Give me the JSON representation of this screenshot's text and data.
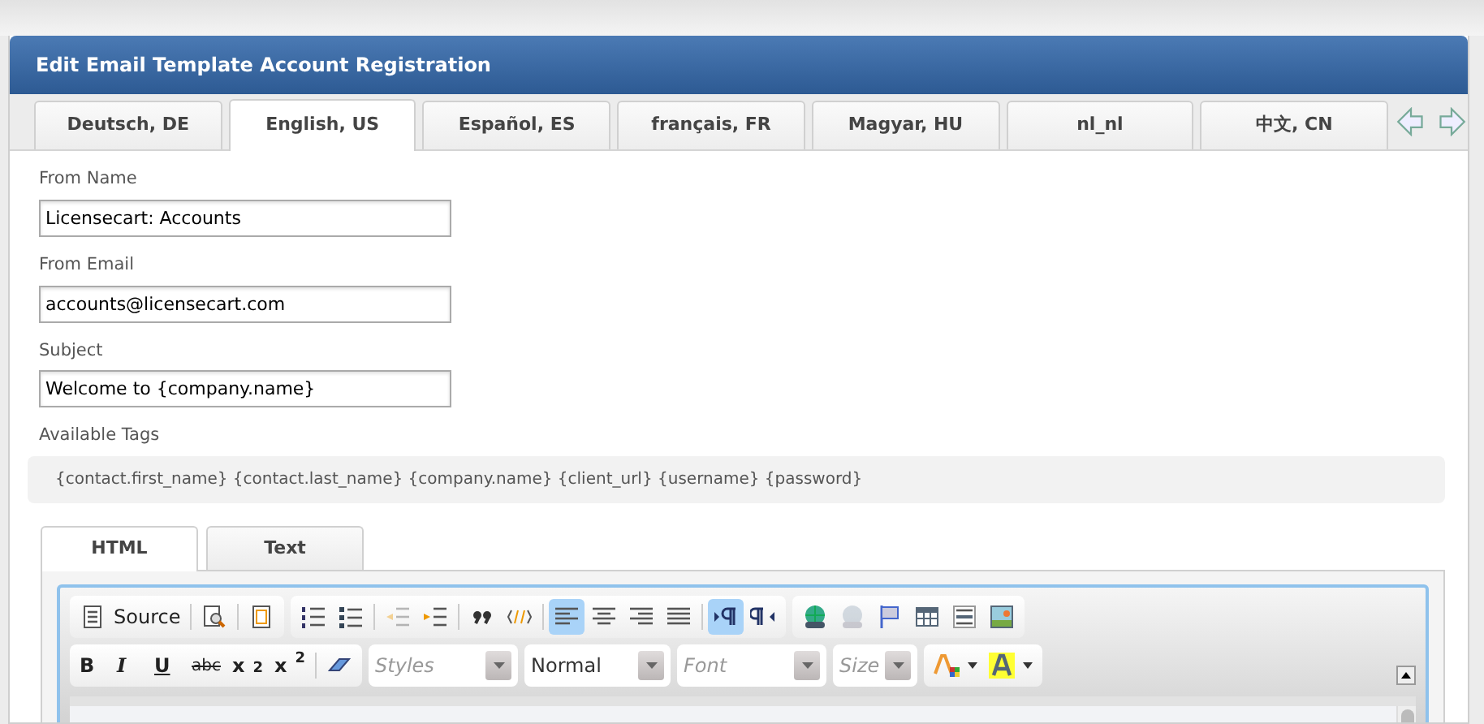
{
  "window": {
    "title": "Edit Email Template Account Registration"
  },
  "language_tabs": [
    {
      "label": "Deutsch, DE",
      "selected": false
    },
    {
      "label": "English, US",
      "selected": true
    },
    {
      "label": "Español, ES",
      "selected": false
    },
    {
      "label": "français, FR",
      "selected": false
    },
    {
      "label": "Magyar, HU",
      "selected": false
    },
    {
      "label": "nl_nl",
      "selected": false
    },
    {
      "label": "中文, CN",
      "selected": false
    }
  ],
  "fields": [
    {
      "label": "From Name",
      "value": "Licensecart: Accounts"
    },
    {
      "label": "From Email",
      "value": "accounts@licensecart.com"
    },
    {
      "label": "Subject",
      "value": "Welcome to {company.name}"
    }
  ],
  "available_tags": {
    "label": "Available Tags",
    "text": "{contact.first_name} {contact.last_name} {company.name} {client_url} {username} {password}"
  },
  "editor_tabs": [
    {
      "label": "HTML",
      "selected": true
    },
    {
      "label": "Text",
      "selected": false
    }
  ],
  "toolbar_row_1": [
    [
      {
        "label": "Source",
        "pressed": false,
        "disabled": false
      },
      {
        "pressed": false,
        "disabled": false
      },
      {
        "pressed": false,
        "disabled": false
      }
    ],
    [
      {
        "pressed": false,
        "disabled": false
      },
      {
        "pressed": false,
        "disabled": false
      },
      {
        "pressed": false,
        "disabled": true
      },
      {
        "pressed": false,
        "disabled": false
      },
      {
        "pressed": false,
        "disabled": false
      },
      {
        "pressed": false,
        "disabled": false
      },
      {
        "pressed": true,
        "disabled": false
      },
      {
        "pressed": false,
        "disabled": false
      },
      {
        "pressed": false,
        "disabled": false
      },
      {
        "pressed": false,
        "disabled": false
      },
      {
        "pressed": true,
        "disabled": false
      },
      {
        "pressed": false,
        "disabled": false
      }
    ],
    [
      {
        "pressed": false,
        "disabled": false
      },
      {
        "pressed": false,
        "disabled": true
      },
      {
        "pressed": false,
        "disabled": false
      },
      {
        "pressed": false,
        "disabled": false
      },
      {
        "pressed": false,
        "disabled": false
      },
      {
        "pressed": false,
        "disabled": false
      }
    ]
  ],
  "toolbar_row_2": {
    "format_buttons": [
      {
        "label": "B",
        "pressed": false,
        "disabled": false
      },
      {
        "label": "I",
        "pressed": false,
        "disabled": false
      },
      {
        "label": "U",
        "pressed": false,
        "disabled": false
      },
      {
        "label": "abc",
        "pressed": false,
        "disabled": false
      },
      {
        "label": "x$_{2}$",
        "pressed": false,
        "disabled": false
      },
      {
        "label": "x$^{2}$",
        "pressed": false,
        "disabled": false
      },
      {
        "pressed": false,
        "disabled": false
      }
    ],
    "dropdowns": [
      {
        "placeholder": "Styles"
      },
      {
        "value": "Normal"
      },
      {
        "placeholder": "Font"
      },
      {
        "placeholder": "Size"
      }
    ],
    "color_buttons": [
      {
        "pressed": false,
        "disabled": false
      },
      {
        "pressed": false,
        "disabled": false
      }
    ]
  }
}
